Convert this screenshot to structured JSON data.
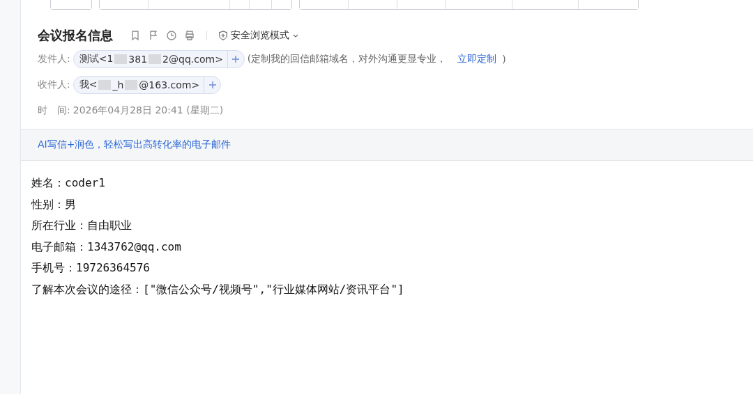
{
  "mail": {
    "subject": "会议报名信息",
    "safe_mode": "安全浏览模式",
    "sender": {
      "label": "发件人:",
      "segments": [
        "测试<1",
        "381",
        "2@qq.com>"
      ],
      "note": "(定制我的回信邮箱域名，对外沟通更显专业，",
      "link": "立即定制",
      "note_end": ")"
    },
    "recipient": {
      "label": "收件人:",
      "segments": [
        "我<",
        "_h",
        "@163.com>"
      ]
    },
    "time": {
      "label": "时　间:",
      "value": "2026年04月28日 20:41 (星期二)"
    },
    "banner": "AI写信+润色，轻松写出高转化率的电子邮件",
    "body": [
      "姓名：coder1",
      "性别：男",
      "所在行业：自由职业",
      "电子邮箱：1343762@qq.com",
      "手机号：19726364576",
      "了解本次会议的途径：[\"微信公众号/视频号\",\"行业媒体网站/资讯平台\"]"
    ]
  }
}
